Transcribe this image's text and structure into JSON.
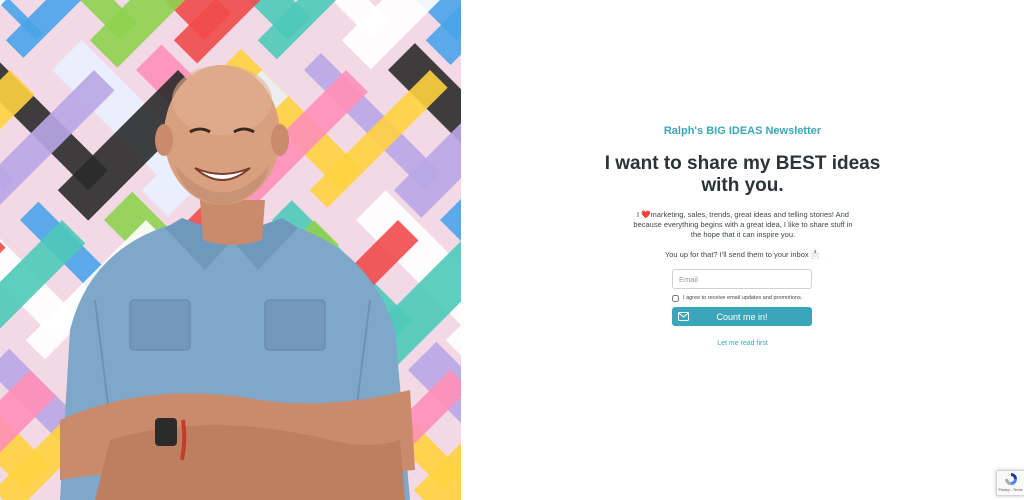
{
  "hero": {
    "palette": {
      "background": "#f3d9e6",
      "stripes": [
        "#4cc9b9",
        "#2a2a2a",
        "#f04a4a",
        "#b9a6e6",
        "#8ed14f",
        "#ffd23f",
        "#4aa3e8",
        "#ff8fb8",
        "#ffffff",
        "#e9f0ff"
      ]
    }
  },
  "newsletter": {
    "brand": "Ralph's BIG IDEAS Newsletter",
    "headline": "I want to share my BEST ideas with you.",
    "lede_prefix": "I",
    "lede_heart": "❤️",
    "lede_body": "marketing, sales, trends, great ideas and telling stories! And because everything begins with a great idea, I like to share stuff in the hope that it can inspire you.",
    "prompt": "You up for that? I'll send them to your inbox 📩",
    "email_placeholder": "Email",
    "email_value": "",
    "consent_label": "I agree to receive email updates and promotions.",
    "consent_checked": false,
    "submit_label": "Count me in!",
    "secondary_link": "Let me read first",
    "accent_color": "#3aa6b9"
  },
  "recaptcha": {
    "links": "Privacy - Terms"
  }
}
